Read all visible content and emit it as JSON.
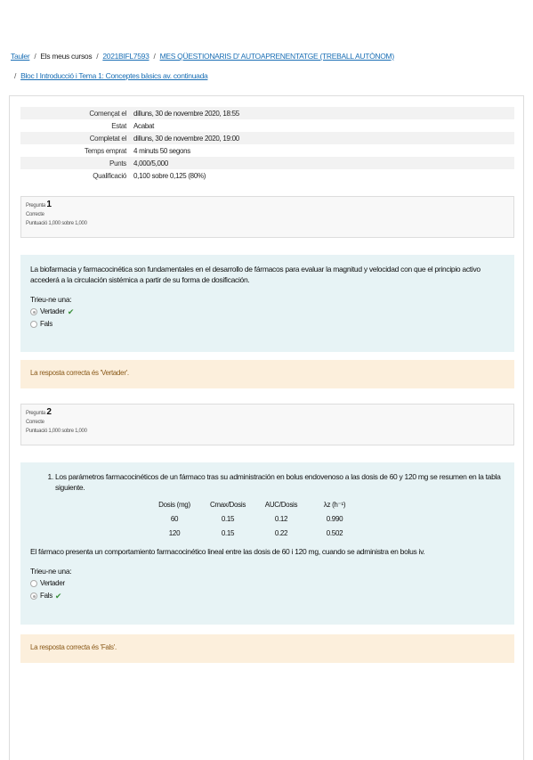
{
  "breadcrumb": {
    "home": "Tauler",
    "my_courses": "Els meus cursos",
    "course": "2021BIFL7593",
    "section": "MES QÜESTIONARIS D' AUTOAPRENENTATGE (TREBALL AUTÒNOM)",
    "quiz": "Bloc I Introducció i Tema 1: Conceptes bàsics av. continuada"
  },
  "summary": [
    {
      "label": "Començat el",
      "value": "dilluns, 30 de novembre 2020, 18:55"
    },
    {
      "label": "Estat",
      "value": "Acabat"
    },
    {
      "label": "Completat el",
      "value": "dilluns, 30 de novembre 2020, 19:00"
    },
    {
      "label": "Temps emprat",
      "value": "4 minuts 50 segons"
    },
    {
      "label": "Punts",
      "value": "4,000/5,000"
    },
    {
      "label": "Qualificació",
      "value": "0,100 sobre 0,125 (80%)"
    }
  ],
  "questions": [
    {
      "prefix": "Pregunta",
      "number": "1",
      "state": "Correcte",
      "mark": "Puntuació 1,000 sobre 1,000",
      "text": "La biofarmacia y farmacocinética son fundamentales en el desarrollo de fármacos para evaluar la magnitud y velocidad con que el principio activo accederá a la circulación sistémica a partir de su forma de dosificación.",
      "prompt": "Trieu-ne una:",
      "answers": [
        "Vertader",
        "Fals"
      ],
      "feedback": "La resposta correcta és 'Vertader'."
    },
    {
      "prefix": "Pregunta",
      "number": "2",
      "state": "Correcte",
      "mark": "Puntuació 1,000 sobre 1,000",
      "text": "Los parámetros farmacocinéticos de un fármaco tras su administración en bolus endovenoso a las dosis de 60 y 120 mg se resumen en la tabla siguiente.",
      "table": {
        "headers": [
          "Dosis (mg)",
          "Cmax/Dosis",
          "AUC/Dosis",
          "λz  (h⁻¹)"
        ],
        "rows": [
          [
            "60",
            "0.15",
            "0.12",
            "0.990"
          ],
          [
            "120",
            "0.15",
            "0.22",
            "0.502"
          ]
        ]
      },
      "statement": "El fármaco presenta un comportamiento farmacocinético lineal entre las dosis de 60 i 120 mg, cuando se administra en bolus iv.",
      "prompt": "Trieu-ne una:",
      "answers": [
        "Vertader",
        "Fals"
      ],
      "feedback": "La resposta correcta és 'Fals'."
    }
  ]
}
